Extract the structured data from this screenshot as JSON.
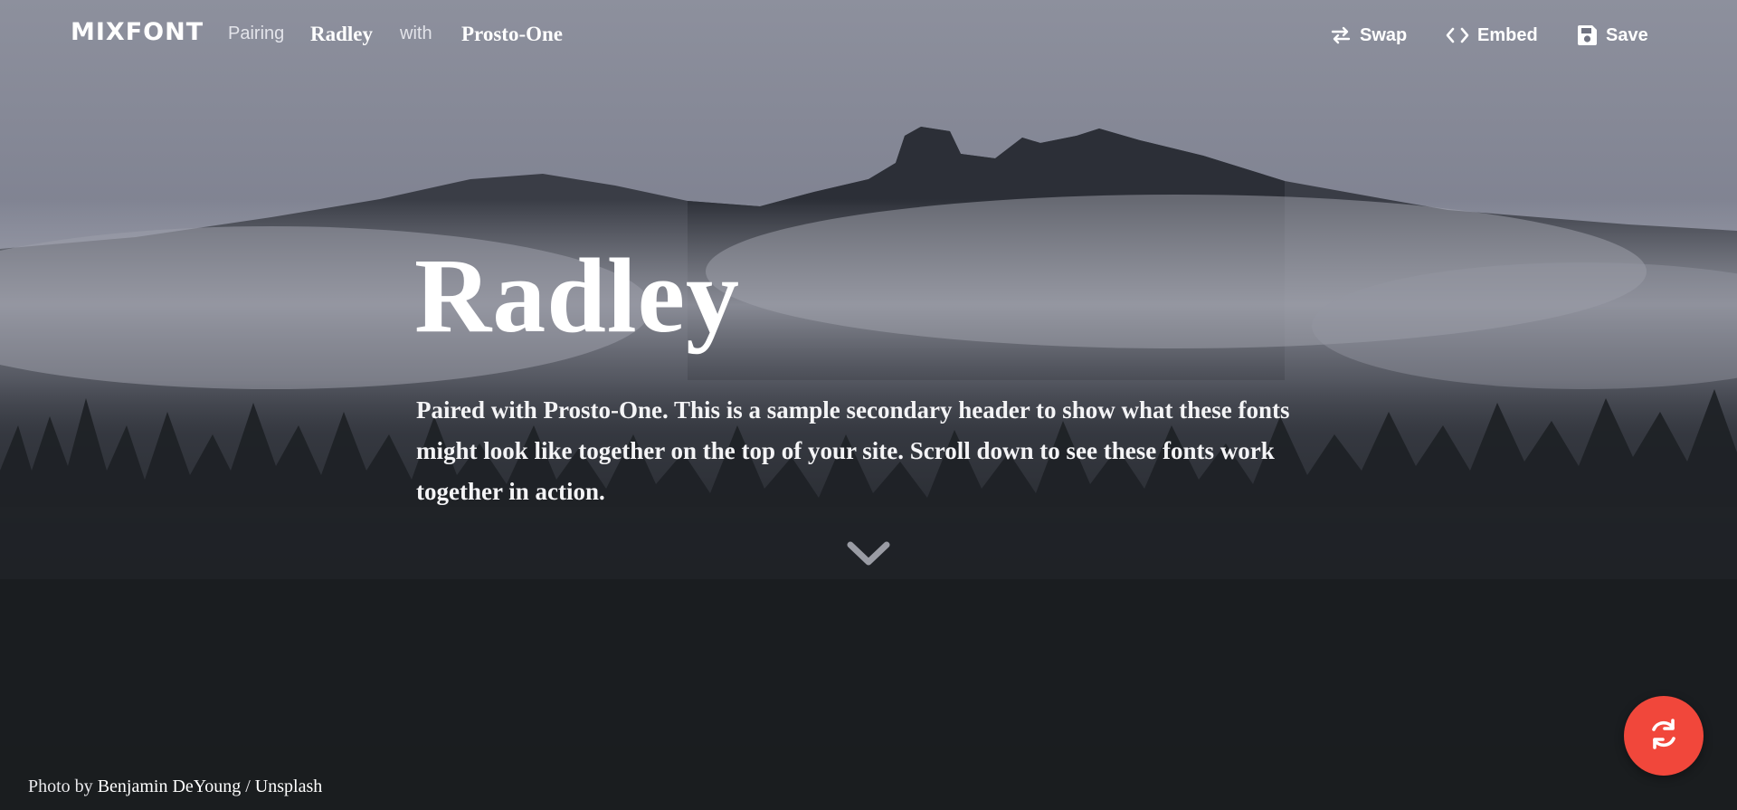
{
  "nav": {
    "logo": "MIXFONT",
    "pairing_label": "Pairing",
    "primary_font": "Radley",
    "with_label": "with",
    "secondary_font": "Prosto-One",
    "actions": {
      "swap": "Swap",
      "embed": "Embed",
      "save": "Save"
    }
  },
  "hero": {
    "headline": "Radley",
    "subtext": "Paired with Prosto-One. This is a sample secondary header to show what these fonts might look like together on the top of your site. Scroll down to see these fonts work together in action."
  },
  "credit": {
    "prefix": "Photo by ",
    "author": "Benjamin DeYoung",
    "separator": " / ",
    "source": "Unsplash"
  },
  "icons": {
    "swap": "swap-arrows-icon",
    "embed": "code-icon",
    "save": "floppy-disk-icon",
    "scroll": "chevron-down-icon",
    "shuffle": "refresh-icon"
  },
  "colors": {
    "fab": "#f1473b",
    "text": "#ffffff"
  }
}
